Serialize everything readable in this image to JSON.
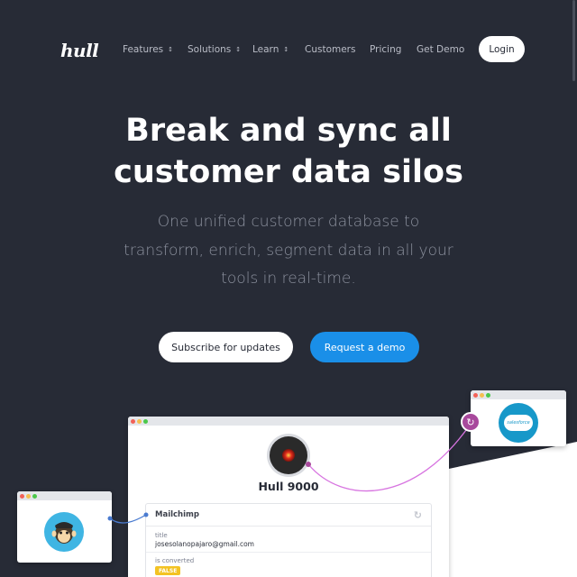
{
  "brand": {
    "logo": "hull"
  },
  "nav": {
    "items": [
      {
        "label": "Features",
        "has_dropdown": true
      },
      {
        "label": "Solutions",
        "has_dropdown": true
      },
      {
        "label": "Learn",
        "has_dropdown": true
      },
      {
        "label": "Customers",
        "has_dropdown": false
      },
      {
        "label": "Pricing",
        "has_dropdown": false
      },
      {
        "label": "Get Demo",
        "has_dropdown": false
      }
    ],
    "login_label": "Login"
  },
  "hero": {
    "title_line1": "Break and sync all",
    "title_line2": "customer data silos",
    "subtitle_line1": "One unified customer database to",
    "subtitle_line2": "transform, enrich, segment data in all your",
    "subtitle_line3": "tools in real-time.",
    "subscribe_label": "Subscribe for updates",
    "demo_label": "Request a demo"
  },
  "illustration": {
    "profile_name": "Hull 9000",
    "card_title": "Mailchimp",
    "fields": [
      {
        "label": "title",
        "value": "josesolanopajaro@gmail.com"
      },
      {
        "label": "is converted",
        "value": "FALSE"
      }
    ],
    "salesforce_label": "salesforce"
  },
  "colors": {
    "background": "#272b36",
    "accent_blue": "#1a8fe8",
    "connector_purple": "#a8499c",
    "connector_blue": "#4a7bd0",
    "badge_yellow": "#f3c323"
  }
}
